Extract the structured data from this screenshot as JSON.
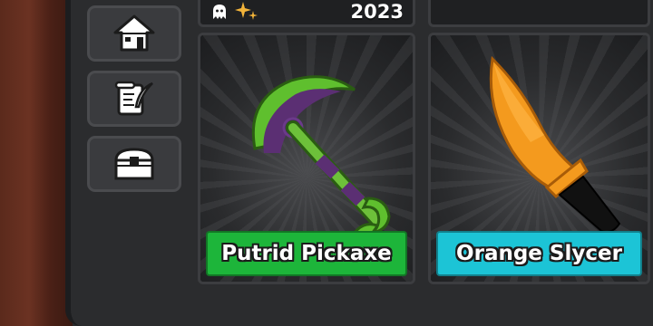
{
  "sidebar": {
    "buttons": [
      {
        "icon": "house-icon"
      },
      {
        "icon": "scroll-quill-icon"
      },
      {
        "icon": "chest-icon"
      }
    ]
  },
  "cards": [
    {
      "year": "2023",
      "badges": [
        "ghost-icon",
        "sparkle-icon"
      ],
      "name": "Putrid Pickaxe",
      "label_color": "#1db53a"
    },
    {
      "name": "Orange Slycer",
      "label_color": "#1cc4d6"
    }
  ]
}
